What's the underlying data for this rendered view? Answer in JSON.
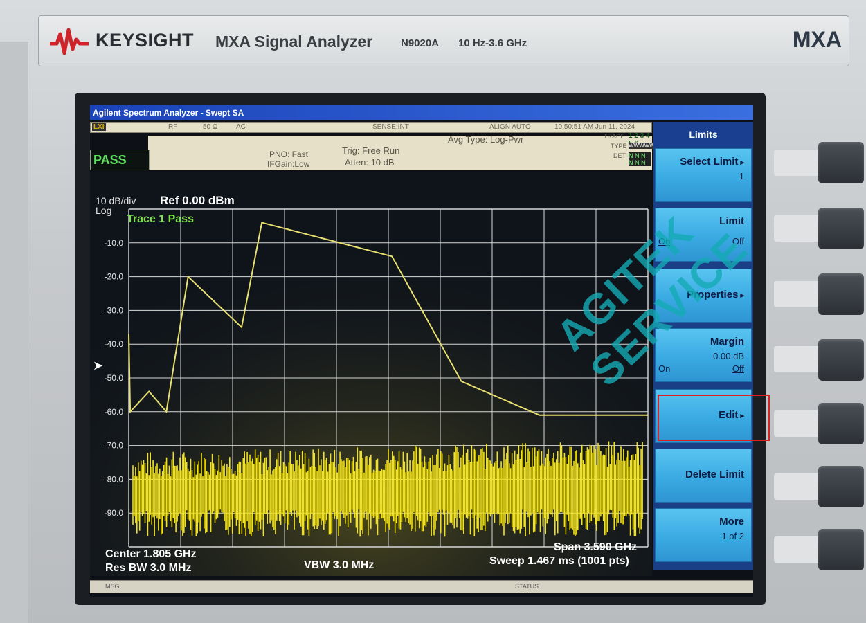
{
  "instrument": {
    "brand": "KEYSIGHT",
    "model": "MXA Signal Analyzer",
    "model_no": "N9020A",
    "freq_range": "10 Hz-3.6 GHz",
    "badge": "MXA"
  },
  "window": {
    "title": "Agilent Spectrum Analyzer - Swept SA"
  },
  "status_strip": {
    "xi": "LXI",
    "input": "RF",
    "impedance": "50 Ω",
    "coupling": "AC",
    "sense": "SENSE:INT",
    "align": "ALIGN AUTO",
    "datetime": "10:50:51 AM Jun 11, 2024"
  },
  "meas": {
    "pass_label": "PASS",
    "pno": "PNO: Fast",
    "ifgain": "IFGain:Low",
    "trig": "Trig: Free Run",
    "atten": "Atten: 10 dB",
    "avg_type": "Avg Type: Log-Pwr",
    "trace_label": "TRACE",
    "trace_nums": "1 2 3 4 5 6",
    "type_label": "TYPE",
    "type_value": "WWWWWW",
    "det_label": "DET",
    "det_value": "N N N N N N"
  },
  "plot": {
    "scale": "10 dB/div",
    "scale_type": "Log",
    "ref_level": "Ref 0.00 dBm",
    "trace_status": "Trace 1 Pass",
    "center": "Center 1.805 GHz",
    "res_bw": "Res BW 3.0 MHz",
    "vbw": "VBW 3.0 MHz",
    "span": "Span 3.590 GHz",
    "sweep": "Sweep  1.467 ms (1001 pts)"
  },
  "softkeys": {
    "menu_title": "Limits",
    "select_limit": "Select Limit",
    "select_limit_val": "1",
    "limit": "Limit",
    "limit_on": "On",
    "limit_off": "Off",
    "properties": "Properties",
    "margin": "Margin",
    "margin_val": "0.00 dB",
    "margin_on": "On",
    "margin_off": "Off",
    "edit": "Edit",
    "delete_limit": "Delete Limit",
    "more": "More",
    "more_page": "1 of 2"
  },
  "msg_bar": {
    "msg": "MSG",
    "status": "STATUS"
  },
  "watermark": "AGITEK SERVICE",
  "chart_data": {
    "type": "line",
    "ylabel": "",
    "xlabel": "",
    "ylim": [
      -100,
      0
    ],
    "y_ticks": [
      "-10.0",
      "-20.0",
      "-30.0",
      "-40.0",
      "-50.0",
      "-60.0",
      "-70.0",
      "-80.0",
      "-90.0"
    ],
    "x_unit": "GHz",
    "x_range": [
      0.01,
      3.6
    ],
    "series": [
      {
        "role": "limit-line",
        "color": "#e8e070",
        "x": [
          0.01,
          0.02,
          0.15,
          0.27,
          0.42,
          0.79,
          0.93,
          1.83,
          2.31,
          2.85,
          3.6
        ],
        "y": [
          -37,
          -60,
          -54,
          -60,
          -20,
          -35,
          -4,
          -14,
          -51,
          -61,
          -61
        ]
      },
      {
        "role": "trace-noise",
        "color": "#f2e21a",
        "level_mean": -79,
        "level_spread": 8
      }
    ]
  }
}
